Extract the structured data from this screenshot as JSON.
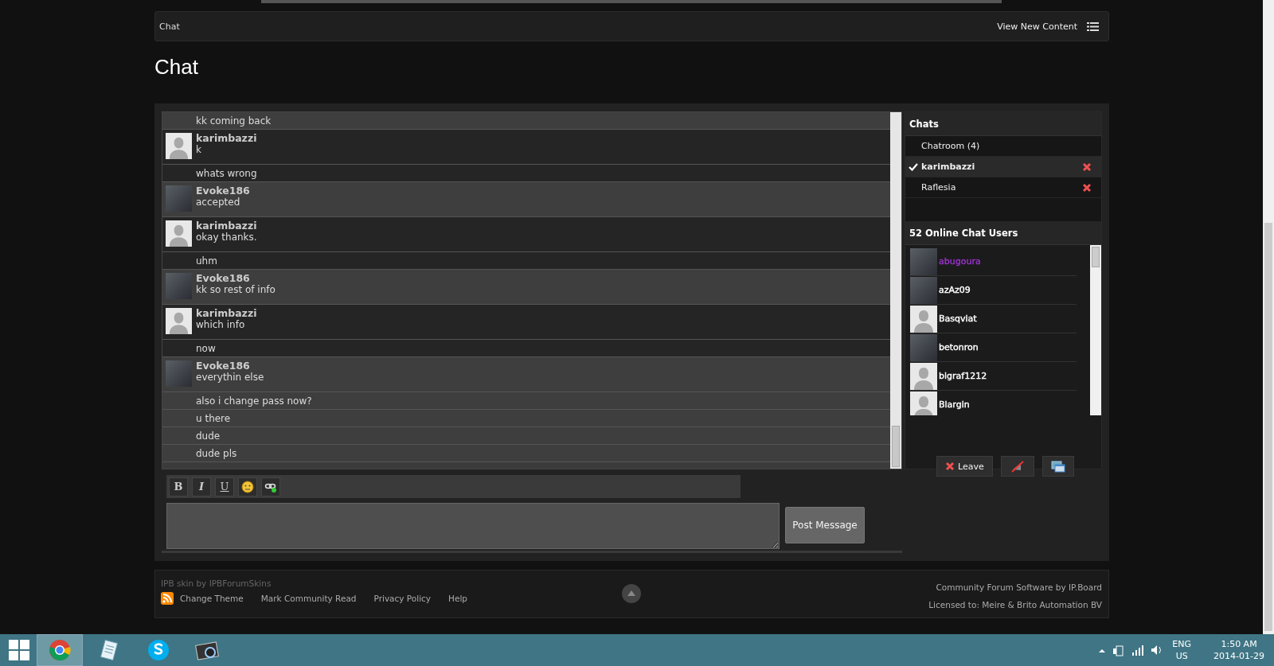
{
  "breadcrumb": {
    "label": "Chat",
    "link": "View New Content"
  },
  "page_title": "Chat",
  "messages": [
    {
      "kind": "line",
      "shaded": true,
      "text": "kk coming back"
    },
    {
      "kind": "post",
      "shaded": false,
      "avatar": {
        "kind": "default"
      },
      "author": "karimbazzi",
      "text": "k"
    },
    {
      "kind": "line",
      "shaded": false,
      "text": "whats wrong"
    },
    {
      "kind": "post",
      "shaded": true,
      "avatar": {
        "kind": "photo"
      },
      "author": "Evoke186",
      "text": "accepted"
    },
    {
      "kind": "post",
      "shaded": false,
      "avatar": {
        "kind": "default"
      },
      "author": "karimbazzi",
      "text": "okay thanks."
    },
    {
      "kind": "line",
      "shaded": false,
      "text": "uhm"
    },
    {
      "kind": "post",
      "shaded": true,
      "avatar": {
        "kind": "photo"
      },
      "author": "Evoke186",
      "text": "kk so rest of info"
    },
    {
      "kind": "post",
      "shaded": false,
      "avatar": {
        "kind": "default"
      },
      "author": "karimbazzi",
      "text": "which info"
    },
    {
      "kind": "line",
      "shaded": false,
      "text": "now"
    },
    {
      "kind": "post",
      "shaded": true,
      "avatar": {
        "kind": "photo"
      },
      "author": "Evoke186",
      "text": "everythin else"
    },
    {
      "kind": "line",
      "shaded": true,
      "text": "also i change pass now?"
    },
    {
      "kind": "line",
      "shaded": true,
      "text": "u there"
    },
    {
      "kind": "line",
      "shaded": true,
      "text": "dude"
    },
    {
      "kind": "line",
      "shaded": true,
      "text": "dude pls"
    }
  ],
  "editor": {
    "tools": [
      {
        "kind": "bold",
        "label": "B"
      },
      {
        "kind": "italic",
        "label": "I"
      },
      {
        "kind": "underline",
        "label": "U"
      },
      {
        "kind": "emoticon"
      },
      {
        "kind": "link"
      }
    ],
    "submit": "Post Message"
  },
  "chats": {
    "title": "Chats",
    "items": [
      {
        "label": "Chatroom (4)",
        "selected": false,
        "closable": false
      },
      {
        "label": "karimbazzi",
        "selected": true,
        "closable": true
      },
      {
        "label": "Raflesia",
        "selected": false,
        "closable": true
      }
    ]
  },
  "online": {
    "title": "52 Online Chat Users",
    "users": [
      {
        "name": "abugoura",
        "avatar": {
          "kind": "photo"
        },
        "color": "#9933cc"
      },
      {
        "name": "azAz09",
        "avatar": {
          "kind": "photo"
        },
        "color": "#ffffff"
      },
      {
        "name": "Basqviat",
        "avatar": {
          "kind": "default"
        },
        "color": "#ffffff"
      },
      {
        "name": "betonron",
        "avatar": {
          "kind": "photo"
        },
        "color": "#ffffff"
      },
      {
        "name": "bigraf1212",
        "avatar": {
          "kind": "default"
        },
        "color": "#ffffff"
      },
      {
        "name": "Blargin",
        "avatar": {
          "kind": "default"
        },
        "color": "#ffffff"
      }
    ]
  },
  "chat_buttons": [
    {
      "kind": "leave",
      "label": "Leave"
    },
    {
      "kind": "mute"
    },
    {
      "kind": "popout"
    }
  ],
  "footer": {
    "skin": "IPB skin by IPBForumSkins",
    "links": [
      "Change Theme",
      "Mark Community Read",
      "Privacy Policy",
      "Help"
    ],
    "powered": "Community Forum Software by IP.Board",
    "license": "Licensed to: Meire & Brito Automation BV"
  },
  "taskbar": {
    "apps": [
      {
        "kind": "browser",
        "selected": true
      },
      {
        "kind": "notepad",
        "selected": false
      },
      {
        "kind": "skype",
        "selected": false
      },
      {
        "kind": "video",
        "selected": false
      }
    ],
    "language": "ENG",
    "region": "US",
    "time": "1:50 AM",
    "date": "2014-01-29"
  }
}
